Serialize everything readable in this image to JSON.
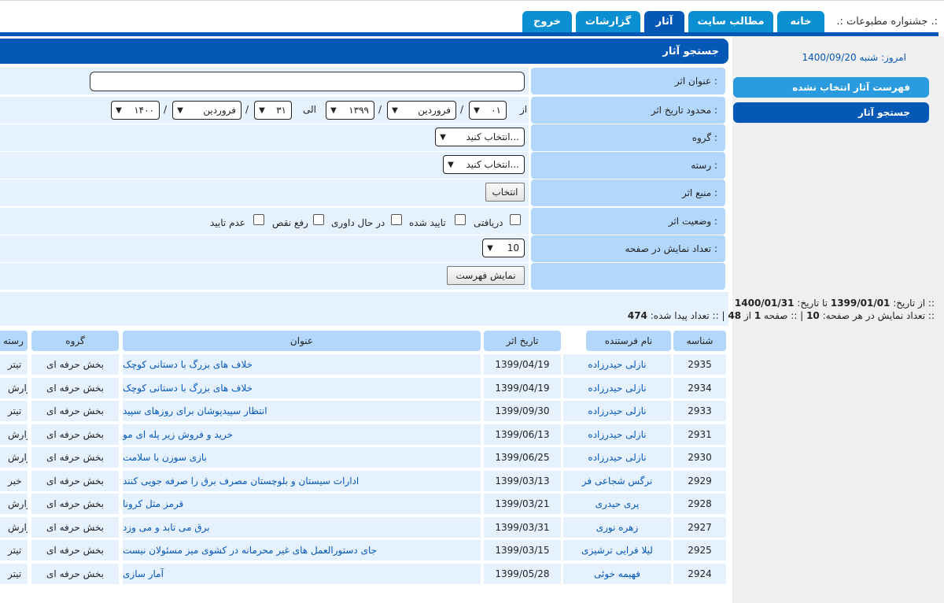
{
  "header": {
    "brand": ".: جشنواره مطبوعات .:",
    "tabs": [
      "خانه",
      "مطالب سایت",
      "آثار",
      "گزارشات",
      "خروج"
    ],
    "active_tab": "آثار"
  },
  "sidebar": {
    "today_label": "امروز: شنبه",
    "today_date": "1400/09/20",
    "items": [
      "فهرست آثار انتخاب نشده",
      "جستجو آثار"
    ]
  },
  "search": {
    "heading": "جستجو آثار",
    "title_label": "عنوان اثر :",
    "title_value": "",
    "date_label": "محدود تاریخ اثر :",
    "from_word": "از",
    "to_word": "الی",
    "slash": "/",
    "from_day": "۰۱",
    "from_month": "فروردین",
    "from_year": "۱۳۹۹",
    "to_day": "۳۱",
    "to_month": "فروردین",
    "to_year": "۱۴۰۰",
    "group_label": "گروه :",
    "group_value": "انتخاب کنید...",
    "category_label": "رسته :",
    "category_value": "انتخاب کنید...",
    "source_label": "منبع اثر :",
    "source_button": "انتخاب",
    "status_label": "وضعیت اثر :",
    "status_options": [
      "دریافتی",
      "تایید شده",
      "در حال داوری",
      "رفع نقص",
      "عدم تایید"
    ],
    "per_page_label": "تعداد نمایش در صفحه :",
    "per_page_value": "10",
    "show_button": "نمایش فهرست"
  },
  "summary": {
    "line1_prefix": ":: از تاریخ:",
    "from_date": "1399/01/01",
    "line1_mid": "تا تاریخ:",
    "to_date": "1400/01/31",
    "line2_a": ":: تعداد نمایش در هر صفحه:",
    "per_page": "10",
    "line2_b": "| :: صفحه",
    "page": "1",
    "line2_c": "از",
    "pages": "48",
    "line2_d": "| :: تعداد پیدا شده:",
    "found": "474"
  },
  "table": {
    "headers": [
      "شناسه",
      "نام فرستنده",
      "تاریخ اثر",
      "عنوان",
      "گروه",
      "رسته"
    ],
    "rows": [
      {
        "id": "2935",
        "sender": "نازلی حیدرزاده",
        "date": "1399/04/19",
        "title": "خلاف های بزرگ با دستانی کوچک",
        "group": "بخش حرفه ای",
        "cat": "تیتر"
      },
      {
        "id": "2934",
        "sender": "نازلی حیدرزاده",
        "date": "1399/04/19",
        "title": "خلاف های بزرگ با دستانی کوچک",
        "group": "بخش حرفه ای",
        "cat": "گزارش"
      },
      {
        "id": "2933",
        "sender": "نازلی حیدرزاده",
        "date": "1399/09/30",
        "title": "انتظار سپیدپوشان برای روزهای سپید",
        "group": "بخش حرفه ای",
        "cat": "تیتر"
      },
      {
        "id": "2931",
        "sender": "نازلی حیدرزاده",
        "date": "1399/06/13",
        "title": "خرید و فروش زیر پله ای مو",
        "group": "بخش حرفه ای",
        "cat": "گزارش"
      },
      {
        "id": "2930",
        "sender": "نازلی حیدرزاده",
        "date": "1399/06/25",
        "title": "بازی سوزن با سلامت",
        "group": "بخش حرفه ای",
        "cat": "گزارش"
      },
      {
        "id": "2929",
        "sender": "نرگس شجاعی فر",
        "date": "1399/03/13",
        "title": "ادارات سیستان و بلوچستان مصرف برق را صرفه جویی کنند",
        "group": "بخش حرفه ای",
        "cat": "خبر"
      },
      {
        "id": "2928",
        "sender": "پری حیدری",
        "date": "1399/03/21",
        "title": "قرمز مثل کرونا",
        "group": "بخش حرفه ای",
        "cat": "گزارش"
      },
      {
        "id": "2927",
        "sender": "زهره نوری",
        "date": "1399/03/31",
        "title": "برق می تابد و می وزد",
        "group": "بخش حرفه ای",
        "cat": "گزارش"
      },
      {
        "id": "2925",
        "sender": "لیلا قرایی ترشیزی",
        "date": "1399/03/15",
        "title": "جای دستورالعمل های غیر محرمانه در کشوی میز مسئولان نیست",
        "group": "بخش حرفه ای",
        "cat": "تیتر"
      },
      {
        "id": "2924",
        "sender": "فهیمه خوئی",
        "date": "1399/05/28",
        "title": "آمار سازی",
        "group": "بخش حرفه ای",
        "cat": "تیتر"
      }
    ]
  }
}
